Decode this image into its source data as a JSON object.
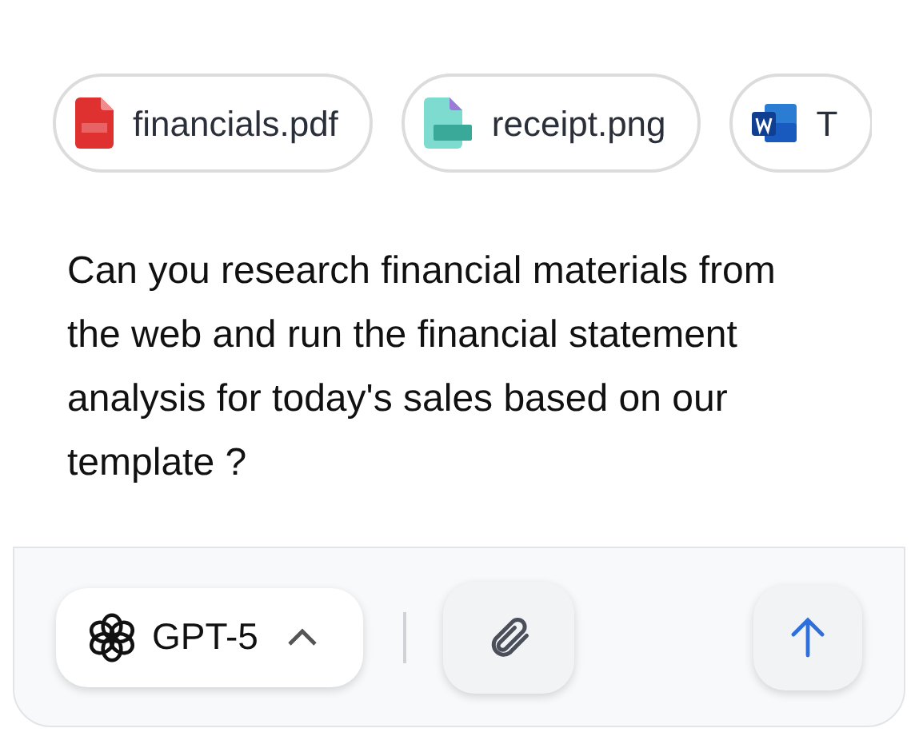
{
  "attachments": [
    {
      "kind": "pdf",
      "name": "financials.pdf"
    },
    {
      "kind": "png",
      "name": "receipt.png"
    },
    {
      "kind": "word",
      "name": "T"
    }
  ],
  "message": "Can you research financial materials from the web and run the financial statement analysis for today's sales based on our template ?",
  "composer": {
    "model": "GPT-5"
  }
}
